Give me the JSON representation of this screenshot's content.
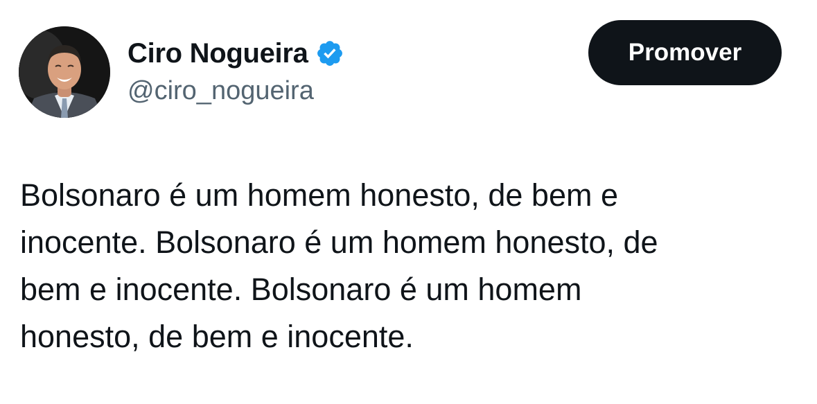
{
  "author": {
    "display_name": "Ciro Nogueira",
    "handle": "@ciro_nogueira",
    "verified": true
  },
  "actions": {
    "promote_label": "Promover"
  },
  "tweet": {
    "lines": [
      "Bolsonaro é um homem honesto, de bem e",
      "inocente. Bolsonaro é um homem honesto, de",
      "bem e inocente. Bolsonaro é um homem",
      "honesto, de bem e inocente."
    ]
  },
  "colors": {
    "text_primary": "#0f1419",
    "text_secondary": "#536471",
    "verified_blue": "#1d9bf0",
    "button_bg": "#0f1419"
  },
  "icons": {
    "verified": "verified-badge-icon"
  }
}
